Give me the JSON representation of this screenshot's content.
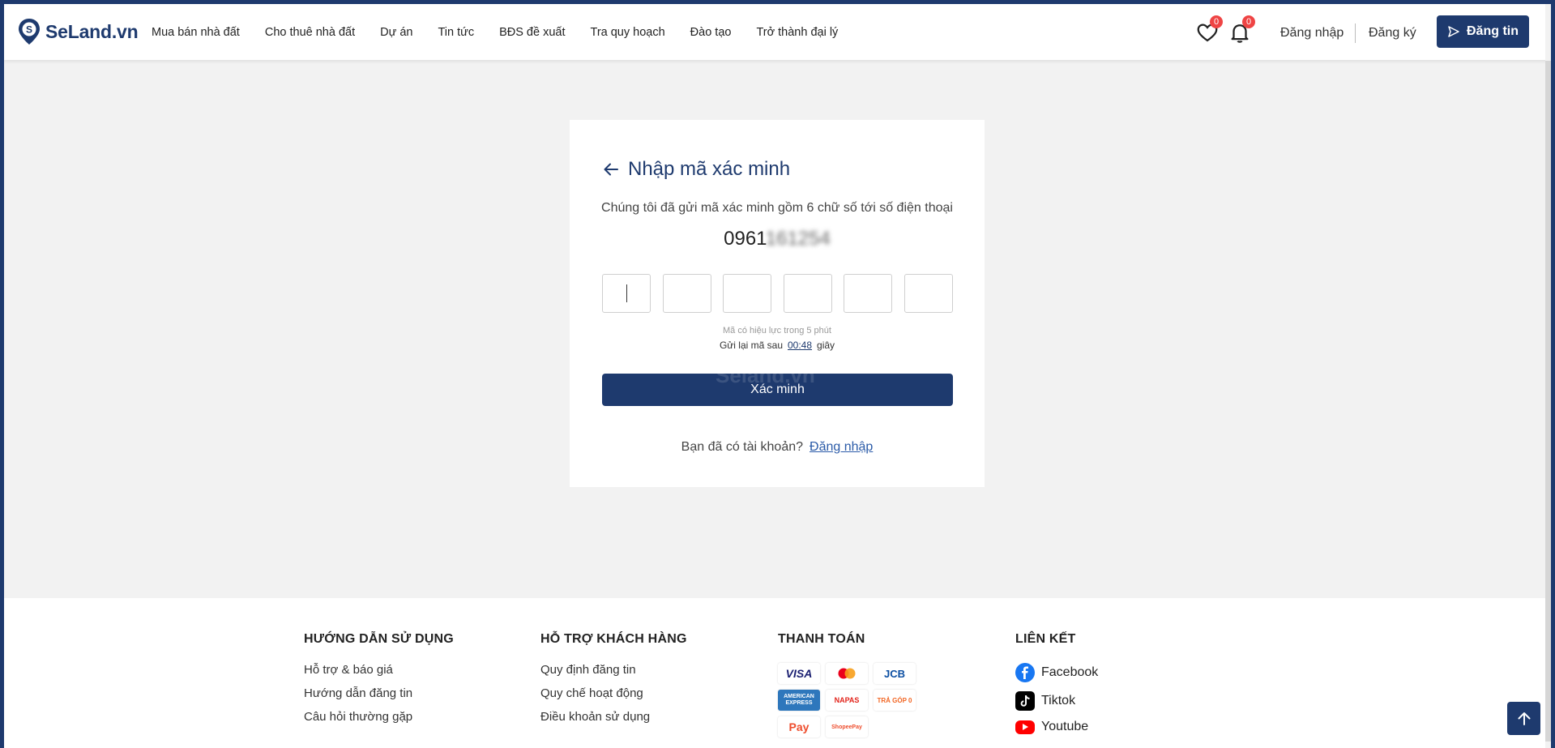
{
  "header": {
    "logo_text": "SeLand.vn",
    "nav": [
      "Mua bán nhà đất",
      "Cho thuê nhà đất",
      "Dự án",
      "Tin tức",
      "BĐS đề xuất",
      "Tra quy hoạch",
      "Đào tạo",
      "Trở thành đại lý"
    ],
    "favorites_count": "0",
    "notifications_count": "0",
    "login": "Đăng nhập",
    "register": "Đăng ký",
    "post_button": "Đăng tin"
  },
  "verify": {
    "title": "Nhập mã xác minh",
    "description": "Chúng tôi đã gửi mã xác minh gồm 6 chữ số tới số điện thoại",
    "phone_prefix": "0961",
    "phone_hidden": "161254",
    "otp_digits": [
      "",
      "",
      "",
      "",
      "",
      ""
    ],
    "valid_note": "Mã có hiệu lực trong 5 phút",
    "resend_prefix": "Gửi lại mã sau",
    "resend_timer": "00:48",
    "resend_suffix": "giây",
    "button": "Xác minh",
    "watermark": "Seland.vn",
    "have_account": "Bạn đã có tài khoản?",
    "login_link": "Đăng nhập"
  },
  "footer": {
    "col1": {
      "title": "HƯỚNG DẪN SỬ DỤNG",
      "items": [
        "Hỗ trợ & báo giá",
        "Hướng dẫn đăng tin",
        "Câu hỏi thường gặp"
      ]
    },
    "col2": {
      "title": "HỖ TRỢ KHÁCH HÀNG",
      "items": [
        "Quy định đăng tin",
        "Quy chế hoạt động",
        "Điều khoản sử dụng"
      ]
    },
    "col3": {
      "title": "THANH TOÁN",
      "payments": [
        "VISA",
        "mastercard",
        "JCB",
        "AMERICAN EXPRESS",
        "NAPAS",
        "TRẢ GÓP 0",
        "Pay",
        "ShopeePay"
      ]
    },
    "col4": {
      "title": "LIÊN KẾT",
      "links": [
        "Facebook",
        "Tiktok",
        "Youtube"
      ]
    }
  },
  "colors": {
    "primary": "#1e3a6e",
    "badge": "#ef4444",
    "link": "#2b5ba8"
  },
  "icons": [
    "heart-icon",
    "bell-icon",
    "send-icon",
    "arrow-left-icon",
    "arrow-up-icon",
    "facebook-icon",
    "tiktok-icon",
    "youtube-icon"
  ]
}
